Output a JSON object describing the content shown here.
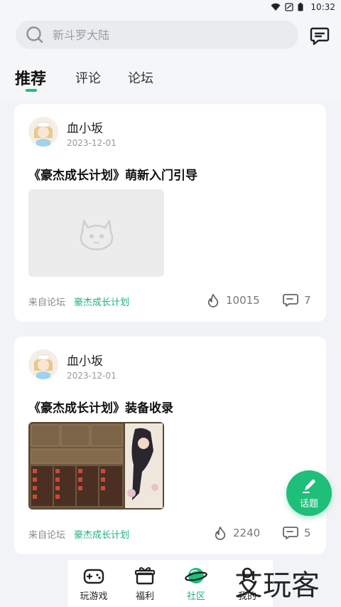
{
  "status_bar": {
    "time": "10:32"
  },
  "search": {
    "placeholder": "新斗罗大陆"
  },
  "tabs": [
    {
      "label": "推荐",
      "active": true
    },
    {
      "label": "评论",
      "active": false
    },
    {
      "label": "论坛",
      "active": false
    }
  ],
  "posts": [
    {
      "author": "血小坂",
      "date": "2023-12-01",
      "title": "《豪杰成长计划》萌新入门引导",
      "image": "placeholder",
      "from_label": "来自论坛",
      "forum": "豪杰成长计划",
      "heat": "10015",
      "comments": "7"
    },
    {
      "author": "血小坂",
      "date": "2023-12-01",
      "title": "《豪杰成长计划》装备收录",
      "image": "game-screenshot",
      "from_label": "来自论坛",
      "forum": "豪杰成长计划",
      "heat": "2240",
      "comments": "5"
    }
  ],
  "fab": {
    "label": "话题"
  },
  "bottom_nav": [
    {
      "label": "玩游戏",
      "icon": "gamepad-icon",
      "active": false
    },
    {
      "label": "福利",
      "icon": "gift-icon",
      "active": false
    },
    {
      "label": "社区",
      "icon": "planet-icon",
      "active": true
    },
    {
      "label": "我的",
      "icon": "profile-icon",
      "active": false
    }
  ],
  "watermark": "艾玩客",
  "colors": {
    "accent": "#1fbf7a",
    "background": "#f2f3f7",
    "forum_link": "#1fb27a"
  }
}
